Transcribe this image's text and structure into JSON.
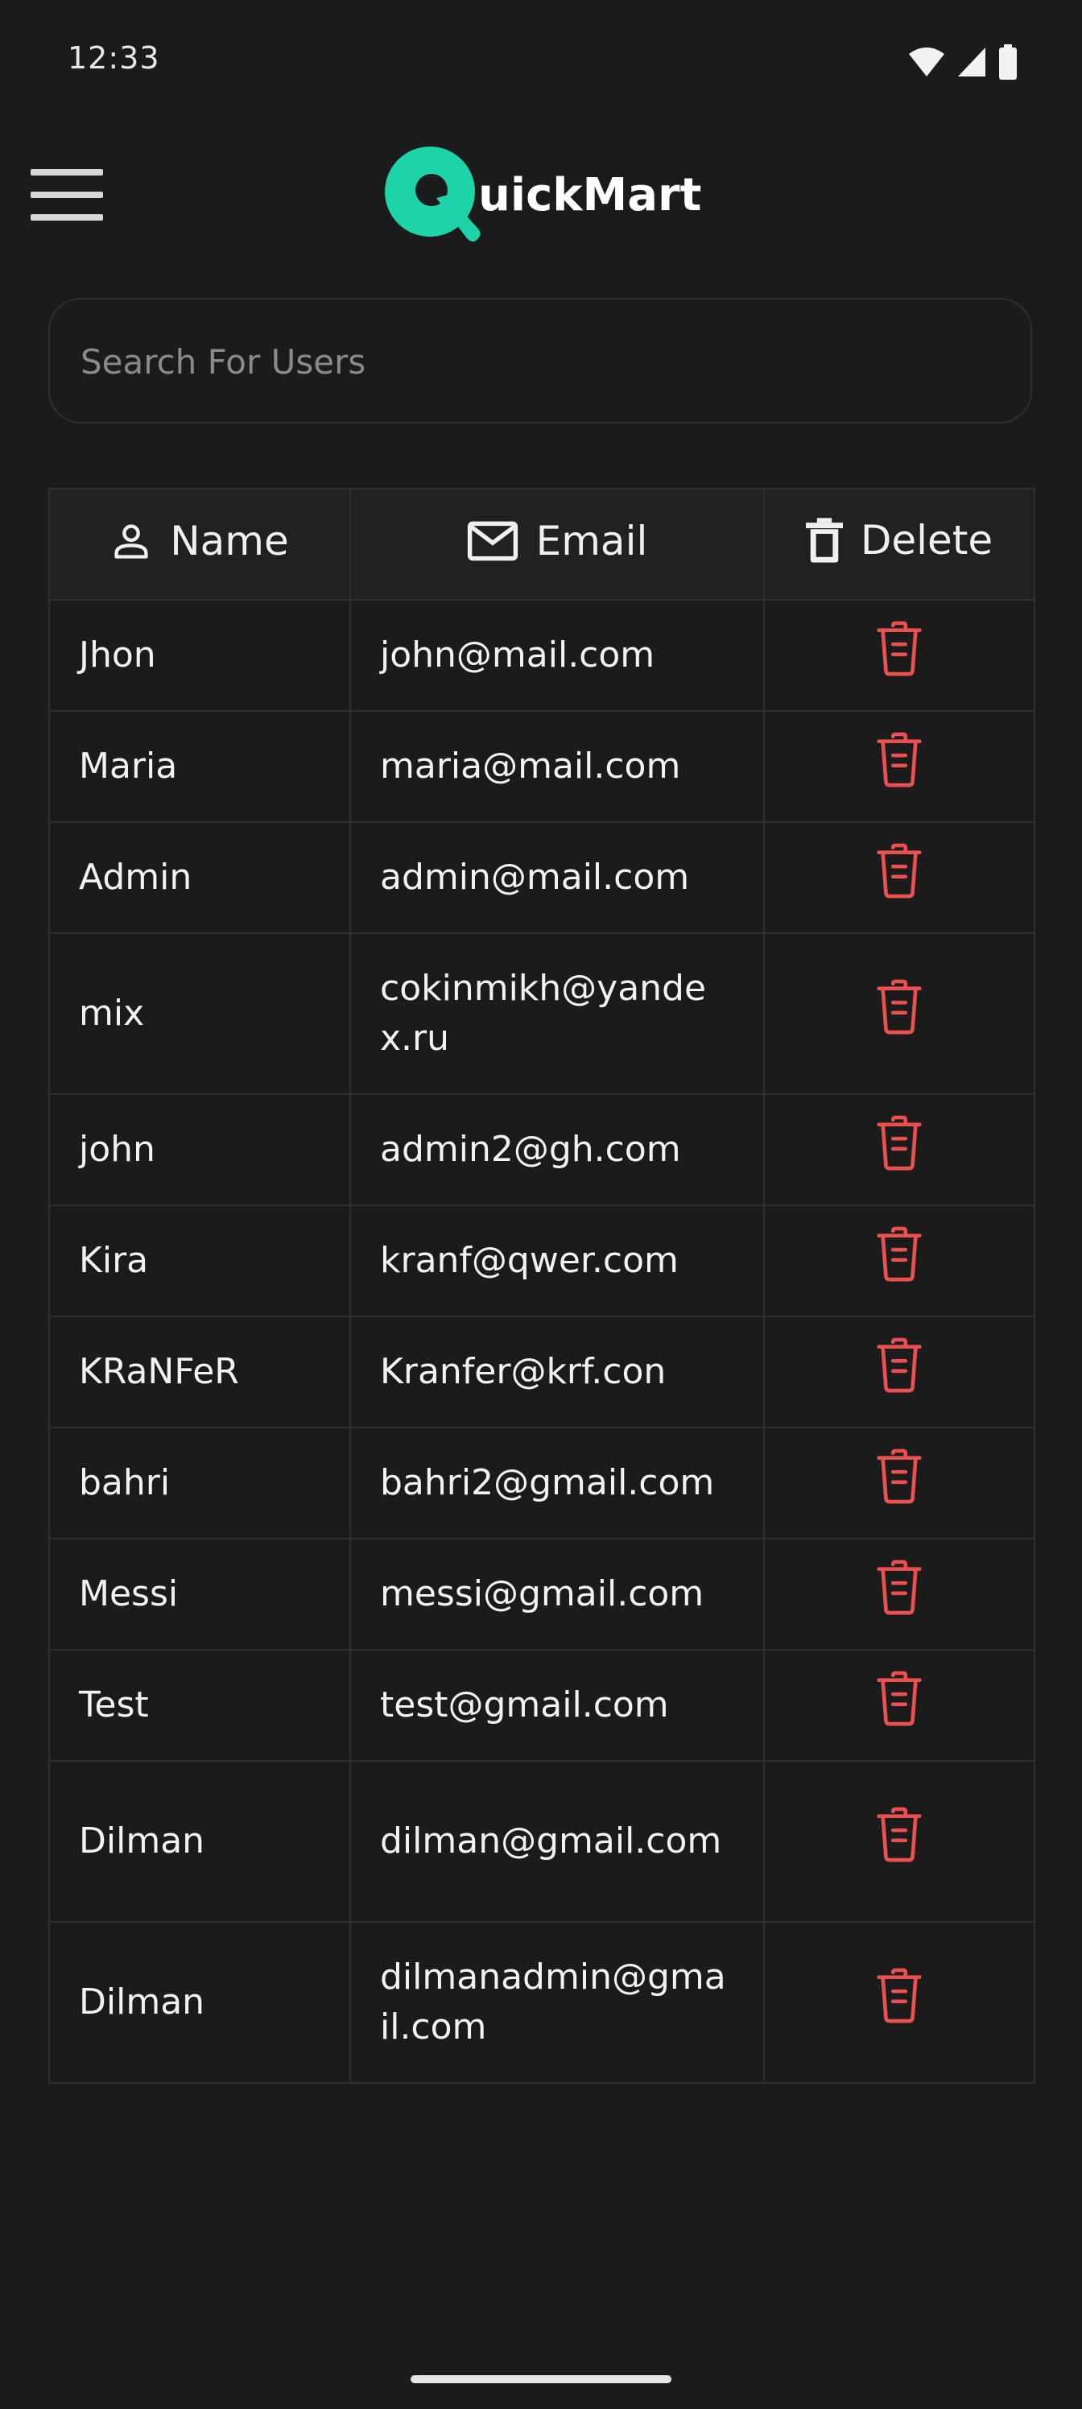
{
  "status_bar": {
    "time": "12:33"
  },
  "app_bar": {
    "logo_text": "uickMart",
    "logo_color": "#1dd3a8"
  },
  "search": {
    "placeholder": "Search For Users",
    "value": ""
  },
  "table": {
    "headers": {
      "name": "Name",
      "email": "Email",
      "delete": "Delete"
    },
    "rows": [
      {
        "name": "Jhon",
        "email": "john@mail.com"
      },
      {
        "name": "Maria",
        "email": "maria@mail.com"
      },
      {
        "name": "Admin",
        "email": "admin@mail.com"
      },
      {
        "name": "mix",
        "email": "cokinmikh@yandex.ru"
      },
      {
        "name": "john",
        "email": "admin2@gh.com"
      },
      {
        "name": "Kira",
        "email": "kranf@qwer.com"
      },
      {
        "name": "KRaNFeR",
        "email": "Kranfer@krf.con"
      },
      {
        "name": "bahri",
        "email": "bahri2@gmail.com"
      },
      {
        "name": "Messi",
        "email": "messi@gmail.com"
      },
      {
        "name": "Test",
        "email": "test@gmail.com"
      },
      {
        "name": "Dilman",
        "email": "dilman@gmail.com"
      },
      {
        "name": "Dilman",
        "email": "dilmanadmin@gmail.com"
      }
    ],
    "delete_icon_color": "#e8514f"
  }
}
